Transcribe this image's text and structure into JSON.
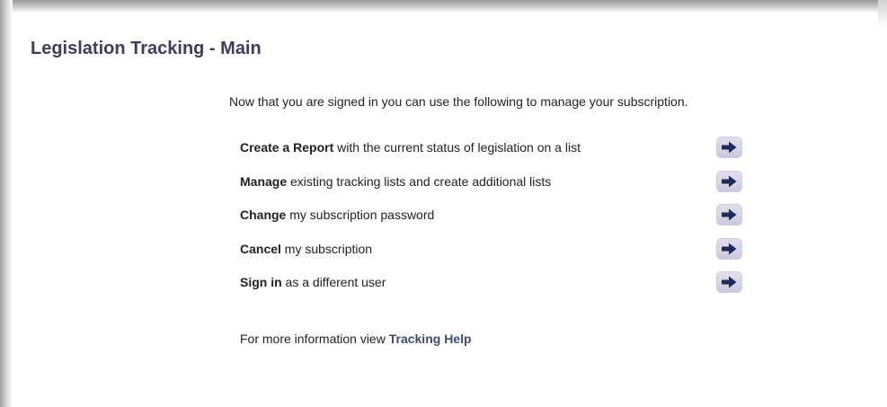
{
  "page": {
    "title": "Legislation Tracking - Main",
    "intro": "Now that you are signed in you can use the following to manage your subscription."
  },
  "actions": [
    {
      "keyword": "Create a Report",
      "text": " with the current status of legislation on a list",
      "icon": "arrow-right-icon"
    },
    {
      "keyword": "Manage",
      "text": " existing tracking lists and create additional lists",
      "icon": "arrow-right-icon"
    },
    {
      "keyword": "Change",
      "text": " my subscription password",
      "icon": "arrow-right-icon"
    },
    {
      "keyword": "Cancel",
      "text": " my subscription",
      "icon": "arrow-right-icon"
    },
    {
      "keyword": "Sign in",
      "text": " as a different user",
      "icon": "arrow-right-icon"
    }
  ],
  "footer": {
    "prefix": "For more information view ",
    "link": "Tracking Help"
  },
  "colors": {
    "title": "#3f3d5c",
    "button_bg": "#d6d3e6",
    "arrow": "#1f2a5a",
    "link": "#3f4b6e"
  }
}
